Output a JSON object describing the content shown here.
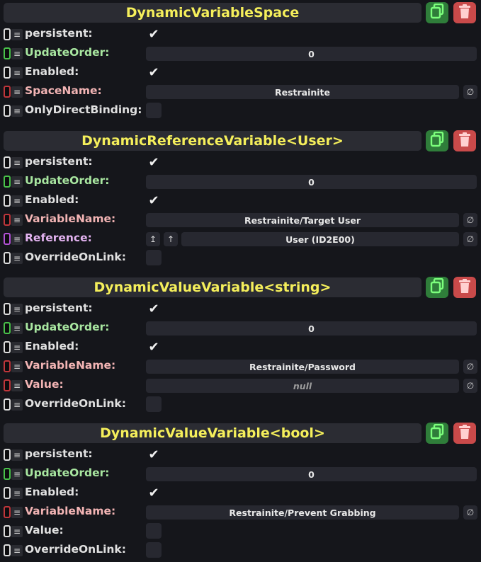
{
  "colors": {
    "header_text": "#f5ef5b",
    "duplicate_button": "#2f7d3a",
    "destroy_button": "#c94a4a",
    "conn_white": "#dcdcdc",
    "conn_green": "#49c24a",
    "conn_red": "#c0363b",
    "conn_purple": "#b251d6"
  },
  "components": [
    {
      "title": "DynamicVariableSpace",
      "fields": [
        {
          "label": "persistent:",
          "kind": "check",
          "checked": true,
          "conn": "white"
        },
        {
          "label": "UpdateOrder:",
          "kind": "value",
          "value": "0",
          "conn": "green"
        },
        {
          "label": "Enabled:",
          "kind": "check",
          "checked": true,
          "conn": "white"
        },
        {
          "label": "SpaceName:",
          "kind": "string",
          "value": "Restrainite",
          "conn": "red"
        },
        {
          "label": "OnlyDirectBinding:",
          "kind": "check",
          "checked": false,
          "conn": "white"
        }
      ]
    },
    {
      "title": "DynamicReferenceVariable<User>",
      "fields": [
        {
          "label": "persistent:",
          "kind": "check",
          "checked": true,
          "conn": "white"
        },
        {
          "label": "UpdateOrder:",
          "kind": "value",
          "value": "0",
          "conn": "green"
        },
        {
          "label": "Enabled:",
          "kind": "check",
          "checked": true,
          "conn": "white"
        },
        {
          "label": "VariableName:",
          "kind": "string",
          "value": "Restrainite/Target User",
          "conn": "red"
        },
        {
          "label": "Reference:",
          "kind": "reference",
          "value": "User  (ID2E00)",
          "conn": "purple"
        },
        {
          "label": "OverrideOnLink:",
          "kind": "check",
          "checked": false,
          "conn": "white"
        }
      ]
    },
    {
      "title": "DynamicValueVariable<string>",
      "fields": [
        {
          "label": "persistent:",
          "kind": "check",
          "checked": true,
          "conn": "white"
        },
        {
          "label": "UpdateOrder:",
          "kind": "value",
          "value": "0",
          "conn": "green"
        },
        {
          "label": "Enabled:",
          "kind": "check",
          "checked": true,
          "conn": "white"
        },
        {
          "label": "VariableName:",
          "kind": "string",
          "value": "Restrainite/Password",
          "conn": "red"
        },
        {
          "label": "Value:",
          "kind": "string-null",
          "value": "null",
          "conn": "red"
        },
        {
          "label": "OverrideOnLink:",
          "kind": "check",
          "checked": false,
          "conn": "white"
        }
      ]
    },
    {
      "title": "DynamicValueVariable<bool>",
      "fields": [
        {
          "label": "persistent:",
          "kind": "check",
          "checked": true,
          "conn": "white"
        },
        {
          "label": "UpdateOrder:",
          "kind": "value",
          "value": "0",
          "conn": "green"
        },
        {
          "label": "Enabled:",
          "kind": "check",
          "checked": true,
          "conn": "white"
        },
        {
          "label": "VariableName:",
          "kind": "string",
          "value": "Restrainite/Prevent Grabbing",
          "conn": "red"
        },
        {
          "label": "Value:",
          "kind": "check",
          "checked": false,
          "conn": "white"
        },
        {
          "label": "OverrideOnLink:",
          "kind": "check",
          "checked": false,
          "conn": "white"
        }
      ]
    }
  ],
  "icons": {
    "duplicate": "duplicate-icon",
    "destroy": "trash-icon",
    "menu": "≡",
    "null_button": "∅",
    "check": "✔",
    "ref_jump": "↥",
    "ref_up": "↑"
  }
}
